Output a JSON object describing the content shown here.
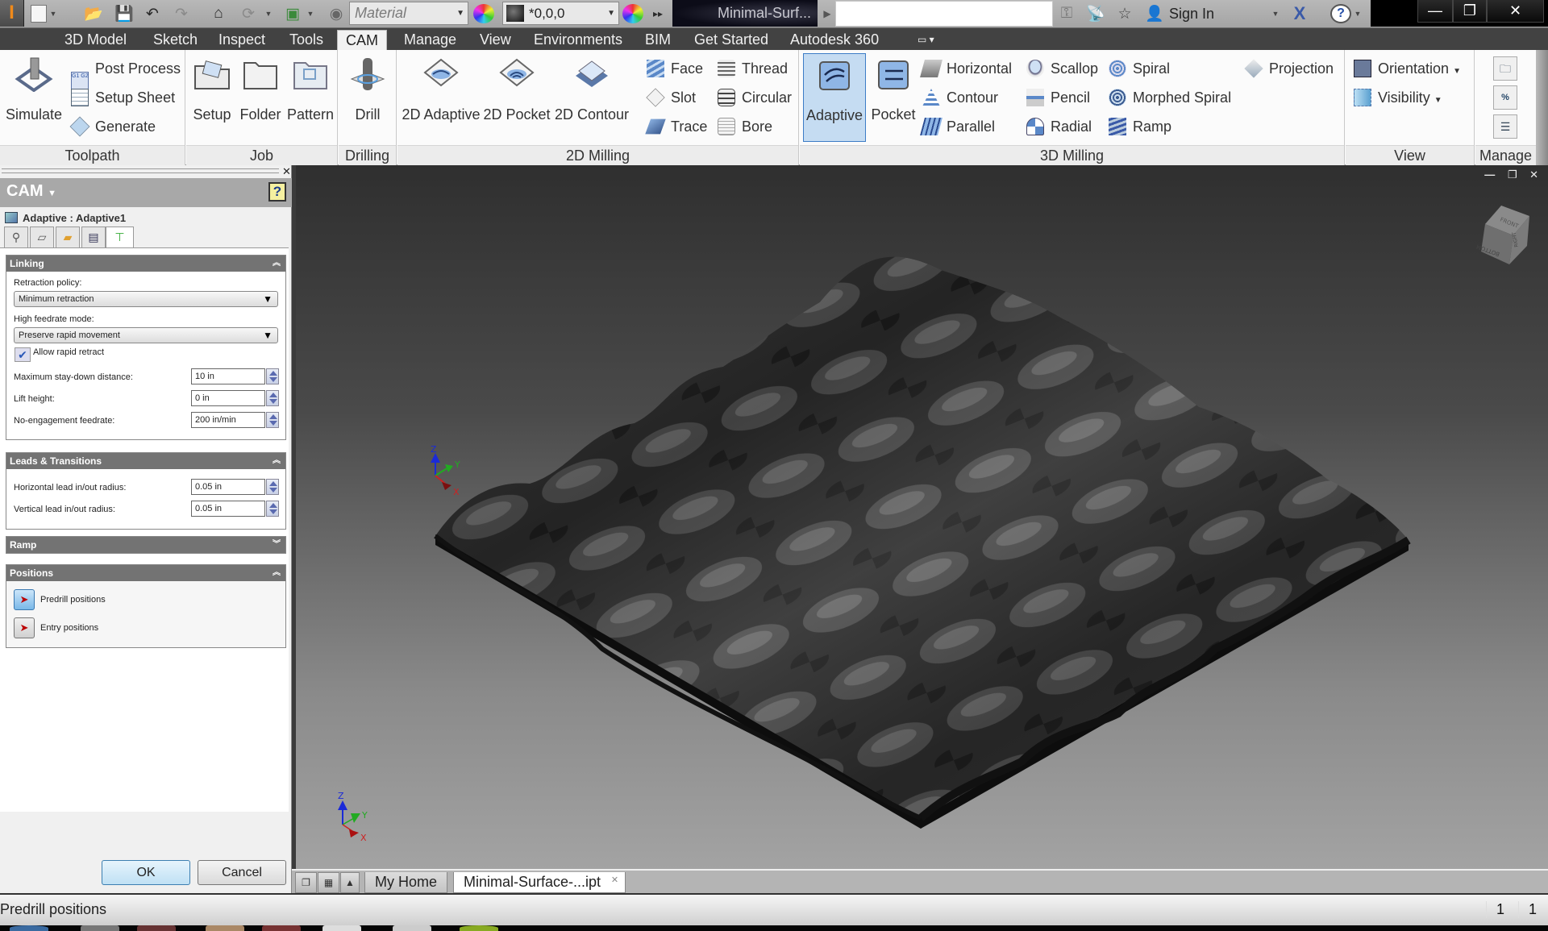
{
  "title_bar": {
    "app_icon": "inventor-logo",
    "quick_access": [
      "new-icon",
      "open-icon",
      "save-icon",
      "undo-icon",
      "redo-icon",
      "home-icon",
      "update-icon",
      "select-priority-icon",
      "material-sphere-icon"
    ],
    "material_placeholder": "Material",
    "appearance_value": "*0,0,0",
    "document_title": "Minimal-Surf...",
    "search_value": "",
    "search_icon": "key-icon",
    "comm_icon": "satellite-icon",
    "favorites_icon": "star-icon",
    "sign_in_label": "Sign In",
    "exchange_icon": "x-icon",
    "help_icon": "question-icon",
    "window_buttons": {
      "minimize": "—",
      "restore": "❐",
      "close": "✕"
    }
  },
  "ribbon_tabs": [
    "3D Model",
    "Sketch",
    "Inspect",
    "Tools",
    "CAM",
    "Manage",
    "View",
    "Environments",
    "BIM",
    "Get Started",
    "Autodesk 360"
  ],
  "active_ribbon_tab": "CAM",
  "ribbon": {
    "toolpath": {
      "title": "Toolpath",
      "simulate": "Simulate",
      "post_process": "Post Process",
      "setup_sheet": "Setup Sheet",
      "generate": "Generate"
    },
    "job": {
      "title": "Job",
      "setup": "Setup",
      "folder": "Folder",
      "pattern": "Pattern"
    },
    "drilling": {
      "title": "Drilling",
      "drill": "Drill"
    },
    "milling2d": {
      "title": "2D Milling",
      "adaptive": "2D Adaptive",
      "pocket": "2D Pocket",
      "contour": "2D Contour",
      "face": "Face",
      "slot": "Slot",
      "trace": "Trace",
      "thread": "Thread",
      "circular": "Circular",
      "bore": "Bore"
    },
    "milling3d": {
      "title": "3D Milling",
      "adaptive": "Adaptive",
      "pocket": "Pocket",
      "horizontal": "Horizontal",
      "contour": "Contour",
      "parallel": "Parallel",
      "scallop": "Scallop",
      "pencil": "Pencil",
      "radial": "Radial",
      "spiral": "Spiral",
      "morphed_spiral": "Morphed Spiral",
      "ramp": "Ramp",
      "projection": "Projection"
    },
    "view": {
      "title": "View",
      "orientation": "Orientation",
      "visibility": "Visibility"
    },
    "manage": {
      "title": "Manage"
    }
  },
  "cam_panel": {
    "title": "CAM",
    "help": "?",
    "operation": "Adaptive : Adaptive1",
    "tabs": [
      "tool-icon",
      "geometry-icon",
      "heights-icon",
      "passes-icon",
      "linking-icon"
    ],
    "active_tab": 4,
    "linking": {
      "title": "Linking",
      "retraction_policy_label": "Retraction policy:",
      "retraction_policy_value": "Minimum retraction",
      "high_feedrate_label": "High feedrate mode:",
      "high_feedrate_value": "Preserve rapid movement",
      "allow_rapid_retract_label": "Allow rapid retract",
      "allow_rapid_retract_checked": true,
      "max_staydown_label": "Maximum stay-down distance:",
      "max_staydown_value": "10 in",
      "lift_height_label": "Lift height:",
      "lift_height_value": "0 in",
      "no_engagement_label": "No-engagement feedrate:",
      "no_engagement_value": "200 in/min"
    },
    "leads": {
      "title": "Leads & Transitions",
      "horizontal_label": "Horizontal lead in/out radius:",
      "horizontal_value": "0.05 in",
      "vertical_label": "Vertical lead in/out radius:",
      "vertical_value": "0.05 in"
    },
    "ramp": {
      "title": "Ramp",
      "collapsed": true
    },
    "positions": {
      "title": "Positions",
      "predrill_label": "Predrill positions",
      "entry_label": "Entry positions"
    },
    "ok_label": "OK",
    "cancel_label": "Cancel"
  },
  "viewport": {
    "viewcube_faces": [
      "FRONT",
      "BOTTOM",
      "RIGHT"
    ],
    "axis_labels": {
      "x": "X",
      "y": "Y",
      "z": "Z"
    },
    "colors": {
      "x": "#cc2222",
      "y": "#22aa22",
      "z": "#1a2ad8"
    }
  },
  "doc_tabs": {
    "home": "My Home",
    "document": "Minimal-Surface-...ipt"
  },
  "status_bar": {
    "text": "Predrill positions",
    "count1": "1",
    "count2": "1"
  }
}
